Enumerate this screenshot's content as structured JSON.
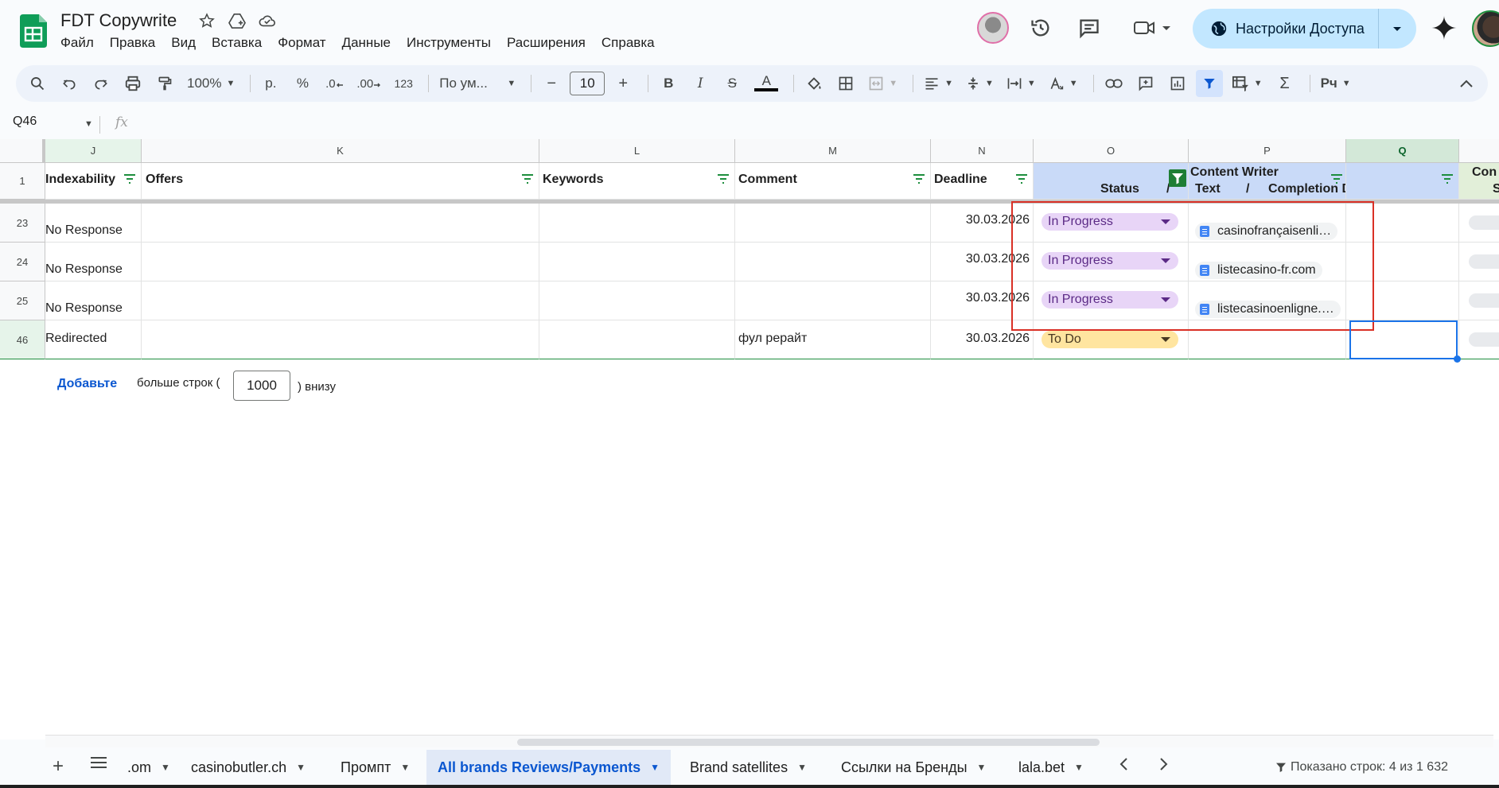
{
  "app": {
    "doc_title": "FDT Copywrite",
    "menu": [
      "Файл",
      "Правка",
      "Вид",
      "Вставка",
      "Формат",
      "Данные",
      "Инструменты",
      "Расширения",
      "Справка"
    ],
    "share_label": "Настройки Доступа"
  },
  "toolbar": {
    "zoom": "100%",
    "currency": "р.",
    "percent": "%",
    "dec_minus": ".0",
    "dec_plus": ".00",
    "number_format": "123",
    "font_name": "По ум...",
    "font_size": "10",
    "minus": "−",
    "plus": "+",
    "bold": "B",
    "italic": "I",
    "strike": "S",
    "text_color": "A",
    "sigma": "Σ",
    "script_menu": "Рч"
  },
  "formula_bar": {
    "name_box": "Q46",
    "fx": "fx"
  },
  "columns": [
    {
      "letter": "J"
    },
    {
      "letter": "K"
    },
    {
      "letter": "L"
    },
    {
      "letter": "M"
    },
    {
      "letter": "N"
    },
    {
      "letter": "O"
    },
    {
      "letter": "P"
    },
    {
      "letter": "Q"
    }
  ],
  "header_row": {
    "row_num": "1",
    "J": "Indexability",
    "K": "Offers",
    "L": "Keywords",
    "M": "Comment",
    "N": "Deadline",
    "O_bottom": "Status",
    "O_slash": "/",
    "P_top": "Content Writer",
    "P_bottom_a": "Text",
    "P_bottom_slash": "/",
    "P_bottom_b": "Completion Date",
    "R_top": "Con",
    "R_bottom": "S"
  },
  "rows": [
    {
      "num": "23",
      "indexability": "No Response",
      "comment": "",
      "deadline": "30.03.2026",
      "status": "In Progress",
      "text_link": "casinofrançaisenli…"
    },
    {
      "num": "24",
      "indexability": "No Response",
      "comment": "",
      "deadline": "30.03.2026",
      "status": "In Progress",
      "text_link": "listecasino-fr.com"
    },
    {
      "num": "25",
      "indexability": "No Response",
      "comment": "",
      "deadline": "30.03.2026",
      "status": "In Progress",
      "text_link": "listecasinoenligne.…"
    },
    {
      "num": "46",
      "indexability": "Redirected",
      "comment": "фул рерайт",
      "deadline": "30.03.2026",
      "status": "To Do",
      "text_link": ""
    }
  ],
  "add_rows": {
    "link": "Добавьте",
    "text_before": "больше строк (",
    "count": "1000",
    "text_after": ") внизу"
  },
  "sheet_tabs": [
    {
      "label": ".om"
    },
    {
      "label": "casinobutler.ch"
    },
    {
      "label": "Промпт"
    },
    {
      "label": "All brands Reviews/Payments",
      "active": true
    },
    {
      "label": "Brand satellites"
    },
    {
      "label": "Ссылки на Бренды"
    },
    {
      "label": "lala.bet"
    }
  ],
  "row_count_status": "Показано строк: 4 из 1 632",
  "colors": {
    "accent": "#0b57d0",
    "share_bg": "#c2e7ff",
    "status_in_progress": "#e8d5f7",
    "status_todo": "#ffe5a0",
    "header_blue": "#c9daf8",
    "annotation_red": "#d93025",
    "selection": "#1a73e8"
  }
}
